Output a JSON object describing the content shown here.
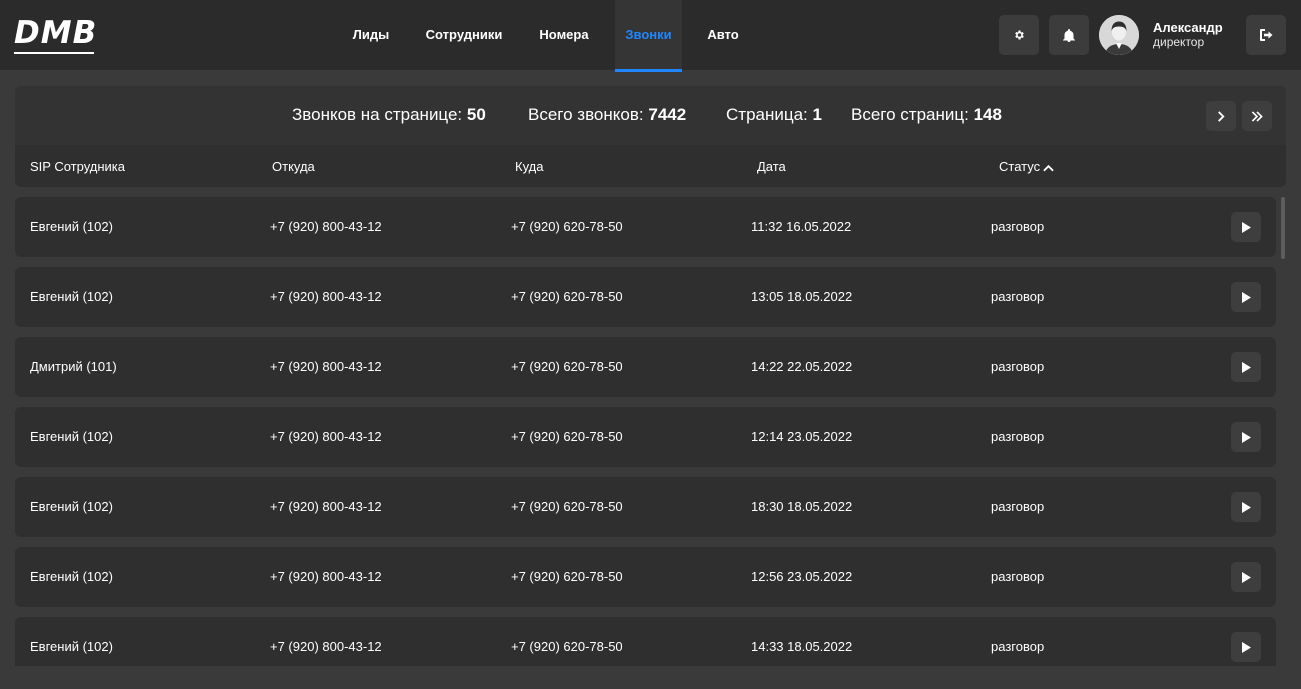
{
  "app": {
    "logo_text": "DMB"
  },
  "nav": {
    "items": [
      {
        "label": "Лиды"
      },
      {
        "label": "Сотрудники"
      },
      {
        "label": "Номера"
      },
      {
        "label": "Звонки",
        "active": true
      },
      {
        "label": "Авто"
      }
    ]
  },
  "header": {
    "settings_icon": "gear-icon",
    "notifications_icon": "bell-icon",
    "logout_icon": "logout-icon",
    "user": {
      "name": "Александр",
      "role": "директор"
    }
  },
  "summary": {
    "calls_per_page_label": "Звонков на странице:",
    "calls_per_page_value": "50",
    "total_calls_label": "Всего звонков:",
    "total_calls_value": "7442",
    "page_label": "Страница:",
    "page_value": "1",
    "total_pages_label": "Всего страниц:",
    "total_pages_value": "148",
    "next_icon": "chevron-right-icon",
    "last_icon": "double-chevron-right-icon"
  },
  "table": {
    "columns": [
      "SIP Сотрудника",
      "Откуда",
      "Куда",
      "Дата",
      "Статус"
    ],
    "sort_icon": "chevron-up-icon",
    "rows": [
      {
        "sip": "Евгений (102)",
        "from": "+7 (920) 800-43-12",
        "to": "+7 (920) 620-78-50",
        "date": "11:32 16.05.2022",
        "status": "разговор"
      },
      {
        "sip": "Евгений (102)",
        "from": "+7 (920) 800-43-12",
        "to": "+7 (920) 620-78-50",
        "date": "13:05 18.05.2022",
        "status": "разговор"
      },
      {
        "sip": "Дмитрий (101)",
        "from": "+7 (920) 800-43-12",
        "to": "+7 (920) 620-78-50",
        "date": "14:22 22.05.2022",
        "status": "разговор"
      },
      {
        "sip": "Евгений (102)",
        "from": "+7 (920) 800-43-12",
        "to": "+7 (920) 620-78-50",
        "date": "12:14 23.05.2022",
        "status": "разговор"
      },
      {
        "sip": "Евгений (102)",
        "from": "+7 (920) 800-43-12",
        "to": "+7 (920) 620-78-50",
        "date": "18:30 18.05.2022",
        "status": "разговор"
      },
      {
        "sip": "Евгений (102)",
        "from": "+7 (920) 800-43-12",
        "to": "+7 (920) 620-78-50",
        "date": "12:56 23.05.2022",
        "status": "разговор"
      },
      {
        "sip": "Евгений (102)",
        "from": "+7 (920) 800-43-12",
        "to": "+7 (920) 620-78-50",
        "date": "14:33 18.05.2022",
        "status": "разговор"
      }
    ],
    "play_icon": "play-icon"
  },
  "colors": {
    "accent": "#1f86ff",
    "background": "#3a3a3a",
    "header": "#2b2b2b",
    "panel": "#2f2f2f"
  }
}
